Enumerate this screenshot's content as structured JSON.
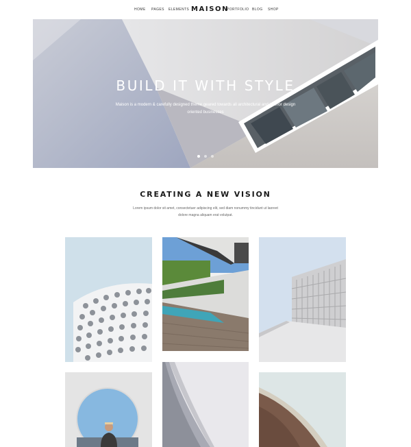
{
  "nav": {
    "left_items": [
      "Home",
      "Pages",
      "Elements"
    ],
    "logo": "MAISON",
    "right_items": [
      "Portfolio",
      "Blog",
      "Shop"
    ]
  },
  "hero": {
    "title": "BUILD IT WITH STYLE",
    "subtitle": "Maison is a modern & carefully designed theme geared towards all architectural and interior design oriented businesses",
    "slides": 3,
    "active_slide": 1
  },
  "section": {
    "title": "CREATING A NEW VISION",
    "description": "Lorem ipsum dolor sit amet, consectetuer adipiscing elit, sed diam nonummy tincidunt ut laoreet dolore magna aliquam erat volutpat."
  },
  "gallery": {
    "tiles": [
      "round-facade-building",
      "modern-house-pool-deck",
      "perforated-facade-building",
      "circular-window-portrait",
      "curved-white-building",
      "curved-roof-detail"
    ]
  }
}
